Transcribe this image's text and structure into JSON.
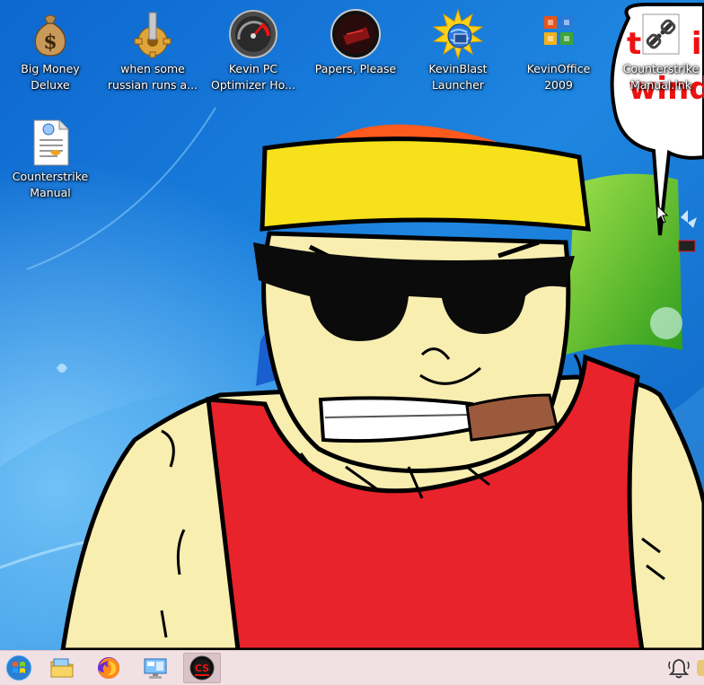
{
  "desktop": {
    "icons": [
      {
        "label": "Big Money\nDeluxe",
        "icon": "money-bag-icon"
      },
      {
        "label": "when some\nrussian runs a...",
        "icon": "gear-icon"
      },
      {
        "label": "Kevin PC\nOptimizer Ho...",
        "icon": "speedometer-icon"
      },
      {
        "label": "Papers, Please",
        "icon": "papers-please-icon"
      },
      {
        "label": "KevinBlast\nLauncher",
        "icon": "globe-burst-icon"
      },
      {
        "label": "KevinOffice\n2009",
        "icon": "office-logo-icon"
      },
      {
        "label": "Counterstrike\nManual.lnk",
        "icon": "shortcut-link-icon"
      },
      {
        "label": "Counterstrike\nManual",
        "icon": "document-icon"
      }
    ]
  },
  "taskbar": {
    "items": [
      {
        "name": "start-button",
        "icon": "windows-orb-icon"
      },
      {
        "name": "file-explorer",
        "icon": "folder-icon"
      },
      {
        "name": "firefox",
        "icon": "firefox-icon"
      },
      {
        "name": "control-panel",
        "icon": "monitor-icon"
      },
      {
        "name": "counterstrike-app",
        "icon": "cs-icon",
        "active": true
      }
    ],
    "tray": [
      {
        "name": "notification",
        "icon": "bell-icon"
      }
    ]
  },
  "colors": {
    "wallpaper_blue": "#1f7fd8",
    "tank_top_red": "#e8232b",
    "headband_yellow": "#f6e11a",
    "skin": "#f8eeb0",
    "taskbar_bg": "#f2e1e4"
  }
}
